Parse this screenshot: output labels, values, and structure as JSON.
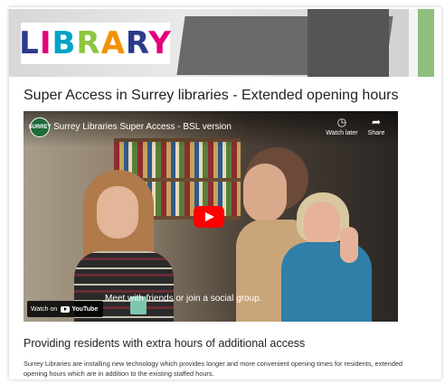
{
  "banner": {
    "logo_letters": [
      "L",
      "I",
      "B",
      "R",
      "A",
      "R",
      "Y"
    ]
  },
  "page": {
    "title": "Super Access in Surrey libraries - Extended opening hours",
    "subheading": "Providing residents with extra hours of additional access",
    "paragraph": "Surrey Libraries are installing new technology which provides longer and more convenient opening times for residents, extended opening hours which are in addition to the existing staffed hours."
  },
  "video": {
    "channel_label": "SURREY",
    "title": "Surrey Libraries Super Access - BSL version",
    "watch_later_label": "Watch later",
    "share_label": "Share",
    "caption": "Meet with friends or join a social group.",
    "watch_on_label": "Watch on",
    "youtube_label": "YouTube"
  },
  "colors": {
    "youtube_red": "#ff0000",
    "surrey_green": "#1f6b3a"
  }
}
